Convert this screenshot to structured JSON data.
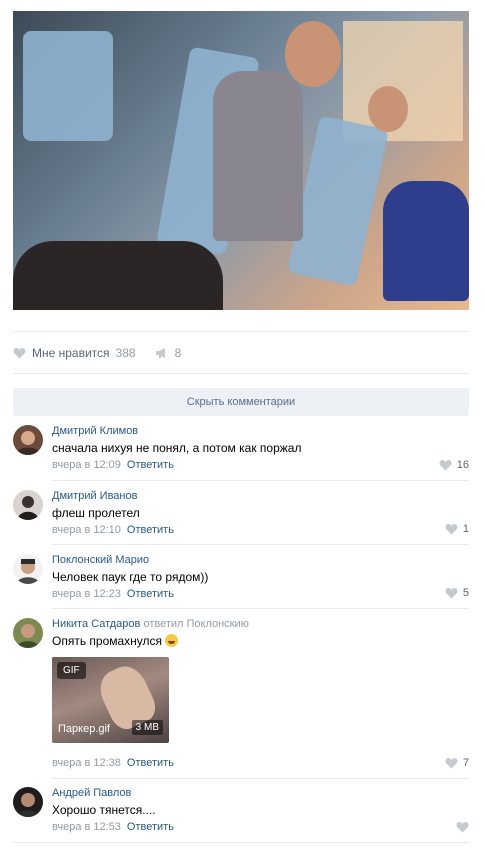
{
  "post": {
    "like_label": "Мне нравится",
    "like_count": "388",
    "share_count": "8"
  },
  "hide_comments_label": "Скрыть комментарии",
  "comments": [
    {
      "author": "Дмитрий Климов",
      "text": "сначала нихуя не понял, а потом как поржал",
      "time": "вчера в 12:09",
      "reply": "Ответить",
      "likes": "16"
    },
    {
      "author": "Дмитрий Иванов",
      "text": "флеш пролетел",
      "time": "вчера в 12:10",
      "reply": "Ответить",
      "likes": "1"
    },
    {
      "author": "Поклонский Марио",
      "text": "Человек паук где то рядом))",
      "time": "вчера в 12:23",
      "reply": "Ответить",
      "likes": "5"
    },
    {
      "author": "Никита Сатдаров",
      "replied_to": "ответил Поклонскию",
      "text": "Опять промахнулся",
      "gif_badge": "GIF",
      "gif_name": "Паркер.gif",
      "gif_size": "3 MB",
      "time": "вчера в 12:38",
      "reply": "Ответить",
      "likes": "7"
    },
    {
      "author": "Андрей Павлов",
      "text": "Хорошо тянется....",
      "time": "вчера в 12:53",
      "reply": "Ответить",
      "likes": ""
    }
  ],
  "icons": {
    "like": "heart-icon",
    "share": "megaphone-icon",
    "emoji": "laughing-emoji-icon"
  },
  "colors": {
    "link": "#2a5885",
    "muted": "#939ba4",
    "button_bg": "#edf0f5"
  }
}
